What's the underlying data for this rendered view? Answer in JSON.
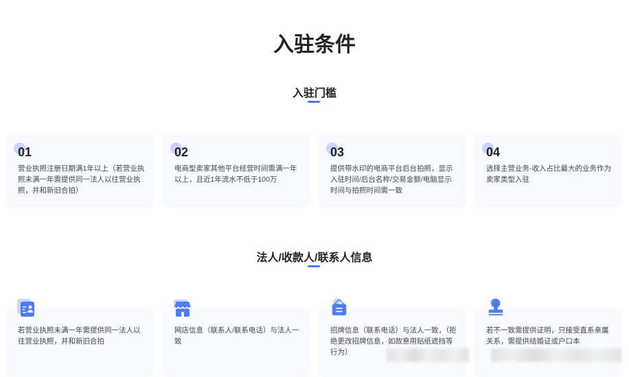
{
  "title": "入驻条件",
  "threshold": {
    "heading": "入驻门槛",
    "accent": "#4d7cf5",
    "cards": [
      {
        "num": "01",
        "text": "营业执照注册日期满1年以上（若营业执照未满一年需提供同一法人以往营业执照，并和新旧合拍）"
      },
      {
        "num": "02",
        "text": "电商型卖家其他平台经营时间需满一年以上，且近1年流水不低于100万"
      },
      {
        "num": "03",
        "text": "提供带水印的电商平台后台拍照，显示入驻时间/后台名称/交易金额/电脑显示时间与拍照时间需一致"
      },
      {
        "num": "04",
        "text": "选择主营业务-收入占比最大的业务作为卖家类型入驻"
      }
    ]
  },
  "info": {
    "heading": "法人/收款人/联系人信息",
    "cards": [
      {
        "icon": "id-card-icon",
        "text": "若营业执照未满一年需提供同一法人以往营业执照，并和新旧合拍"
      },
      {
        "icon": "store-icon",
        "text": "网店信息（联系人/联系电话）与法人一致"
      },
      {
        "icon": "signboard-icon",
        "text": "招牌信息（联系电话）与法人一致，（拒绝更改招牌信息，如故意用贴纸遮挡等行为）"
      },
      {
        "icon": "stamp-icon",
        "text": "若不一致需提供证明，只接受直系亲属关系，需提供结婚证或户口本"
      }
    ]
  }
}
